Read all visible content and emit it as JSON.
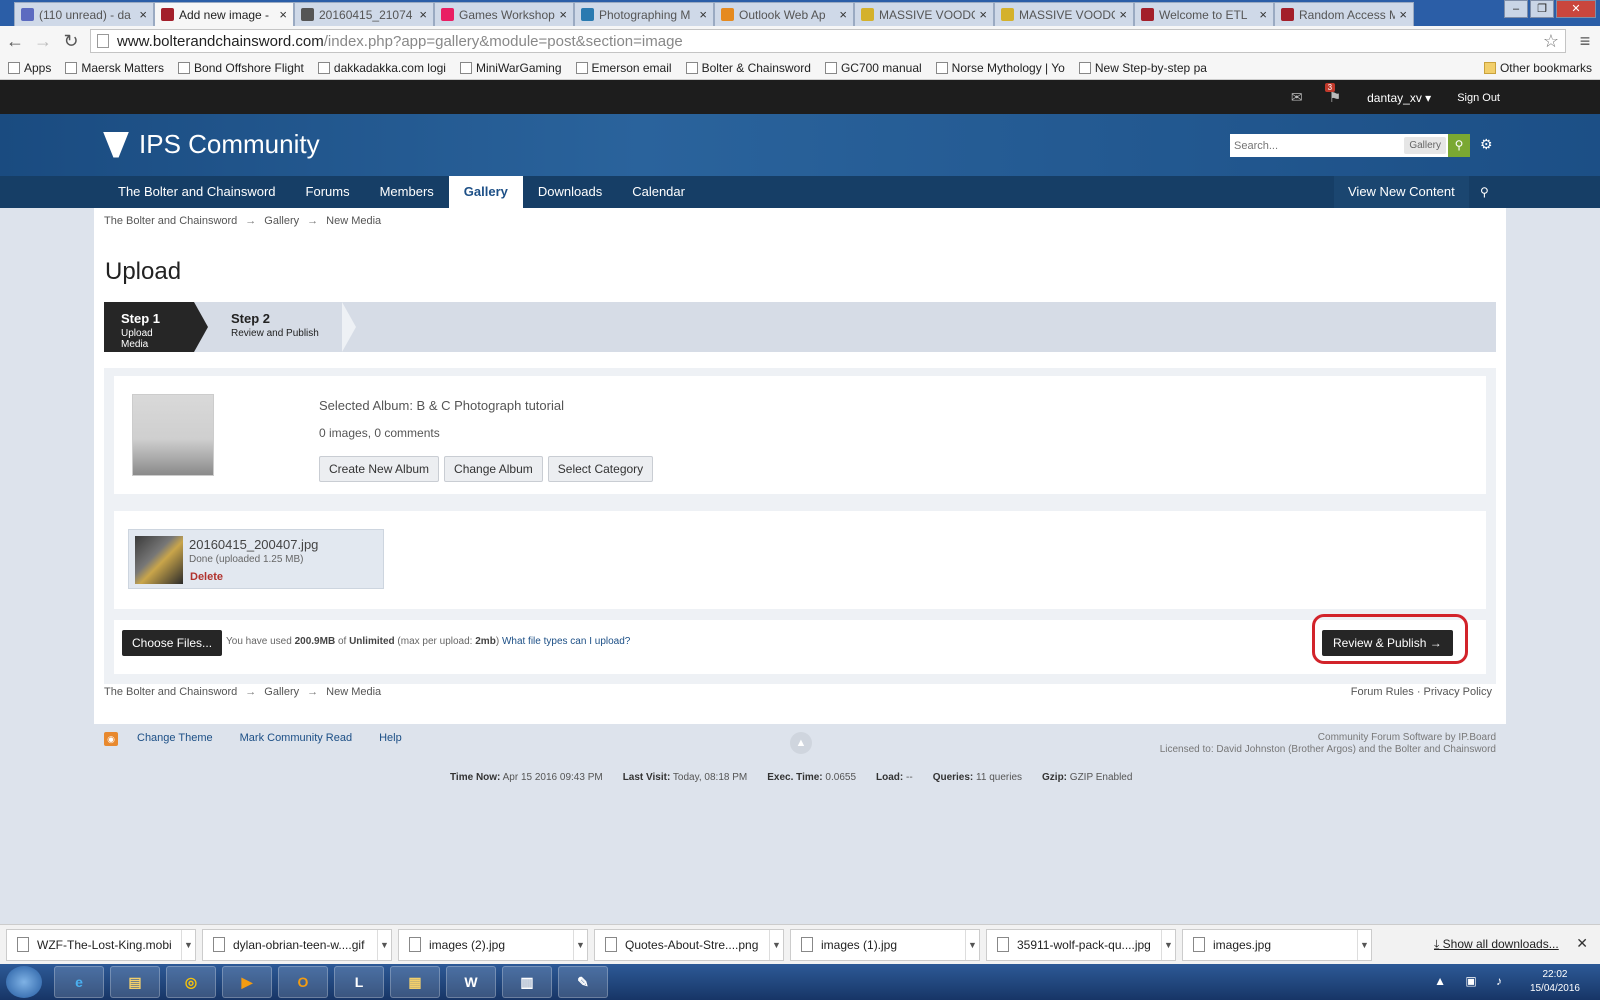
{
  "browser": {
    "tabs": [
      {
        "label": "(110 unread) - da",
        "color": "#5c6bc0"
      },
      {
        "label": "Add new image -",
        "color": "#a31f2a",
        "active": true
      },
      {
        "label": "20160415_21074",
        "color": "#555555"
      },
      {
        "label": "Games Workshop",
        "color": "#e91e63"
      },
      {
        "label": "Photographing M",
        "color": "#2a7ab0"
      },
      {
        "label": "Outlook Web Ap",
        "color": "#e58a1f"
      },
      {
        "label": "MASSIVE VOODO",
        "color": "#d4b12b"
      },
      {
        "label": "MASSIVE VOODO",
        "color": "#d4b12b"
      },
      {
        "label": "Welcome to ETL",
        "color": "#a31f2a"
      },
      {
        "label": "Random Access M",
        "color": "#a31f2a"
      }
    ],
    "url_host": "www.bolterandchainsword.com",
    "url_path": "/index.php?app=gallery&module=post&section=image",
    "bookmarks": [
      "Apps",
      "Maersk Matters",
      "Bond Offshore Flight",
      "dakkadakka.com logi",
      "MiniWarGaming",
      "Emerson email",
      "Bolter & Chainsword",
      "GC700 manual",
      "Norse Mythology | Yo",
      "New Step-by-step pa"
    ],
    "other_bookmarks": "Other bookmarks"
  },
  "userbar": {
    "notif_count": "3",
    "username": "dantay_xv ▾",
    "signout": "Sign Out"
  },
  "header": {
    "logo": "IPS Community",
    "search_placeholder": "Search...",
    "search_scope": "Gallery"
  },
  "nav": {
    "tabs": [
      "The Bolter and Chainsword",
      "Forums",
      "Members",
      "Gallery",
      "Downloads",
      "Calendar"
    ],
    "view_new": "View New Content"
  },
  "breadcrumb": [
    "The Bolter and Chainsword",
    "Gallery",
    "New Media"
  ],
  "page_title": "Upload",
  "steps": [
    {
      "title": "Step 1",
      "sub": "Upload Media"
    },
    {
      "title": "Step 2",
      "sub": "Review and Publish"
    }
  ],
  "album": {
    "selected": "Selected Album: B & C Photograph tutorial",
    "count": "0 images, 0 comments",
    "buttons": [
      "Create New Album",
      "Change Album",
      "Select Category"
    ]
  },
  "file": {
    "name": "20160415_200407.jpg",
    "status": "Done (uploaded 1.25 MB)",
    "delete": "Delete"
  },
  "upload": {
    "choose": "Choose Files...",
    "used_prefix": "You have used",
    "used": "200.9MB",
    "of": "of",
    "limit": "Unlimited",
    "max_prefix": "(max per upload:",
    "max": "2mb",
    "max_suffix": ")",
    "types_link": "What file types can I upload?",
    "review": "Review & Publish →"
  },
  "footer_right": "Forum Rules · Privacy Policy",
  "page_footer": {
    "links": [
      "Change Theme",
      "Mark Community Read",
      "Help"
    ],
    "credit1": "Community Forum Software by IP.Board",
    "credit2": "Licensed to: David Johnston (Brother Argos) and the Bolter and Chainsword",
    "stats": [
      {
        "k": "Time Now:",
        "v": "Apr 15 2016 09:43 PM"
      },
      {
        "k": "Last Visit:",
        "v": "Today, 08:18 PM"
      },
      {
        "k": "Exec. Time:",
        "v": "0.0655"
      },
      {
        "k": "Load:",
        "v": "--"
      },
      {
        "k": "Queries:",
        "v": "11 queries"
      },
      {
        "k": "Gzip:",
        "v": "GZIP Enabled"
      }
    ]
  },
  "downloads": {
    "items": [
      "WZF-The-Lost-King.mobi",
      "dylan-obrian-teen-w....gif",
      "images (2).jpg",
      "Quotes-About-Stre....png",
      "images (1).jpg",
      "35911-wolf-pack-qu....jpg",
      "images.jpg"
    ],
    "show_all": "Show all downloads..."
  },
  "taskbar": {
    "time": "22:02",
    "date": "15/04/2016"
  }
}
